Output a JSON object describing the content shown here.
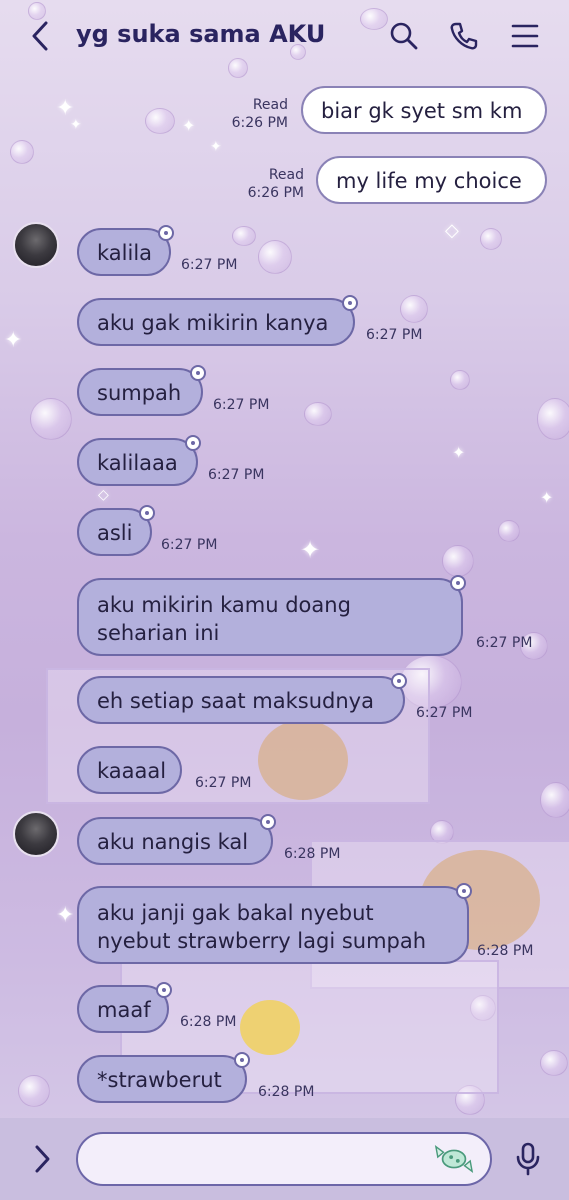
{
  "header": {
    "title": "yg suka sama AKU",
    "icons": [
      "back-chevron-icon",
      "search-icon",
      "phone-icon",
      "menu-icon"
    ]
  },
  "messages": [
    {
      "id": "m1",
      "side": "sent",
      "text": "biar gk syet sm km",
      "status": "Read",
      "time": "6:26 PM"
    },
    {
      "id": "m2",
      "side": "sent",
      "text": "my life my choice",
      "status": "Read",
      "time": "6:26 PM"
    },
    {
      "id": "m3",
      "side": "received",
      "text": "kalila",
      "time": "6:27 PM"
    },
    {
      "id": "m4",
      "side": "received",
      "text": "aku gak mikirin kanya",
      "time": "6:27 PM"
    },
    {
      "id": "m5",
      "side": "received",
      "text": "sumpah",
      "time": "6:27 PM"
    },
    {
      "id": "m6",
      "side": "received",
      "text": "kalilaaa",
      "time": "6:27 PM"
    },
    {
      "id": "m7",
      "side": "received",
      "text": "asli",
      "time": "6:27 PM"
    },
    {
      "id": "m8",
      "side": "received",
      "text": "aku mikirin kamu doang seharian ini",
      "time": "6:27 PM"
    },
    {
      "id": "m9",
      "side": "received",
      "text": "eh setiap saat maksudnya",
      "time": "6:27 PM"
    },
    {
      "id": "m10",
      "side": "received",
      "text": "kaaaal",
      "time": "6:27 PM"
    },
    {
      "id": "m11",
      "side": "received",
      "text": "aku nangis kal",
      "time": "6:28 PM"
    },
    {
      "id": "m12",
      "side": "received",
      "text": "aku janji gak bakal nyebut nyebut strawberry lagi sumpah",
      "time": "6:28 PM"
    },
    {
      "id": "m13",
      "side": "received",
      "text": "maaf",
      "time": "6:28 PM"
    },
    {
      "id": "m14",
      "side": "received",
      "text": "*strawberut",
      "time": "6:28 PM"
    }
  ],
  "input": {
    "placeholder": "",
    "icons": [
      "expand-chevron-icon",
      "sticker-candy-icon",
      "microphone-icon"
    ]
  },
  "colors": {
    "sent_bubble": "#ffffff",
    "received_bubble": "#b3b0dc",
    "bubble_border": "#6d68a6",
    "title": "#2a2460"
  }
}
